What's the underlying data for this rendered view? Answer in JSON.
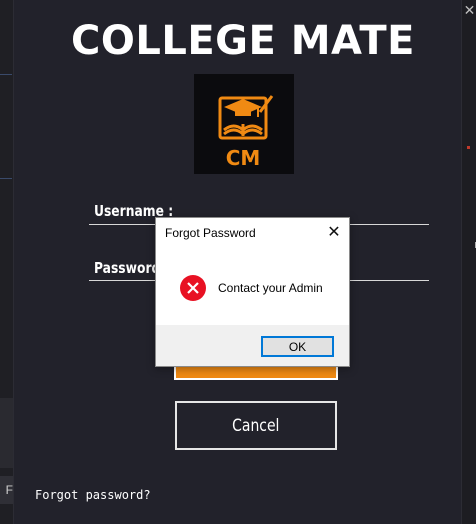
{
  "app": {
    "title": "COLLEGE MATE",
    "logo_text": "CM",
    "brand_color": "#f08a13"
  },
  "form": {
    "username_label": "Username :",
    "password_label": "Password",
    "cancel_label": "Cancel",
    "forgot_link": "Forgot password?"
  },
  "dialog": {
    "title": "Forgot Password",
    "message": "Contact your Admin",
    "ok_label": "OK",
    "close_glyph": "✕",
    "icon": "error-icon"
  },
  "background": {
    "left_panel_glyph": "F",
    "right_close_glyph": "✕"
  }
}
